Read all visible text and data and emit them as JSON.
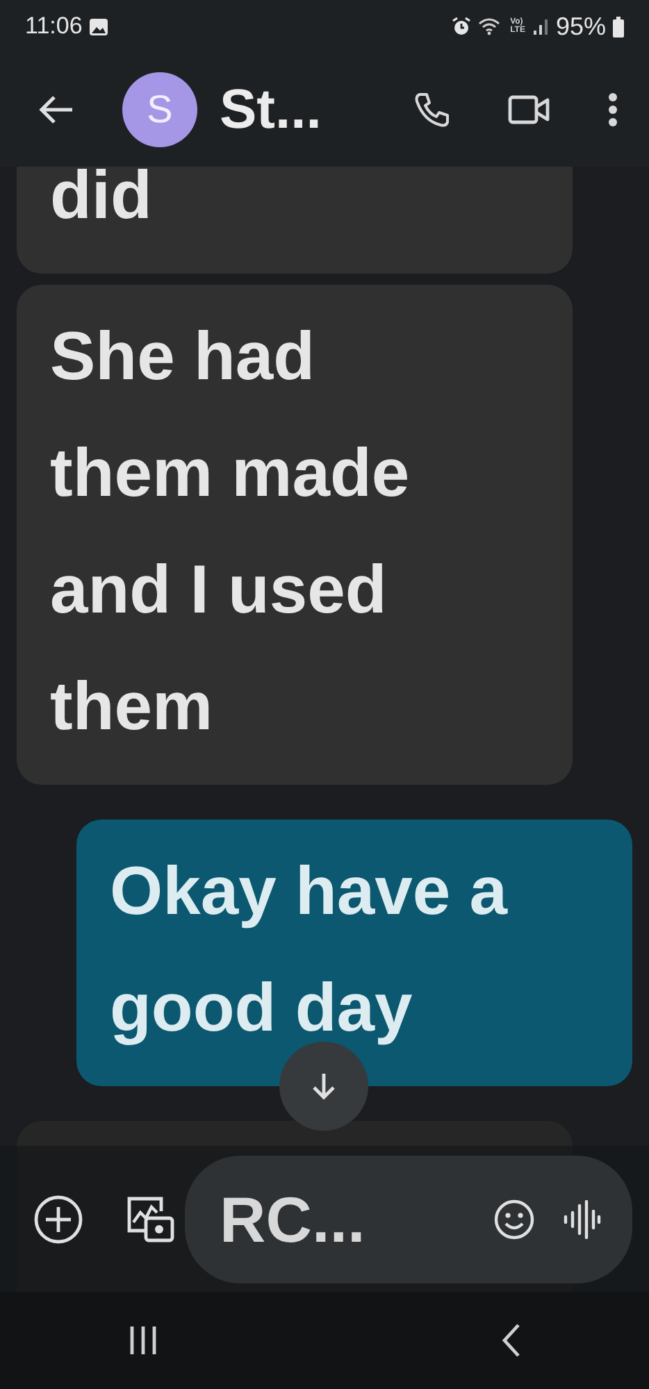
{
  "status_bar": {
    "time": "11:06",
    "network_lines": [
      "Vo)",
      "LTE"
    ],
    "battery": "95%"
  },
  "header": {
    "avatar_letter": "S",
    "contact_name": "St..."
  },
  "messages": [
    {
      "kind": "incoming",
      "lines": [
        "did"
      ]
    },
    {
      "kind": "incoming",
      "lines": [
        "She had",
        "them made",
        "and I used",
        "them"
      ]
    },
    {
      "kind": "outgoing",
      "lines": [
        "Okay have a",
        "good day"
      ]
    },
    {
      "kind": "incoming"
    }
  ],
  "composer": {
    "value": "RC..."
  }
}
